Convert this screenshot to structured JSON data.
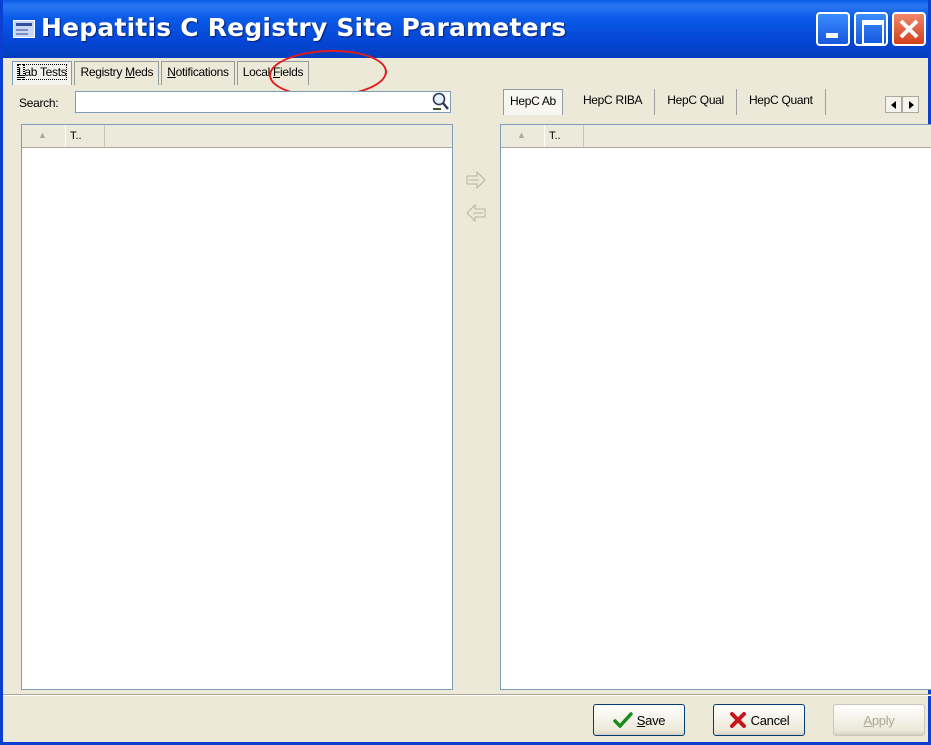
{
  "window": {
    "title": "Hepatitis C Registry Site Parameters"
  },
  "main_tabs": [
    {
      "pre": "",
      "u": "L",
      "post": "ab Tests"
    },
    {
      "pre": "Registry ",
      "u": "M",
      "post": "eds"
    },
    {
      "pre": "",
      "u": "N",
      "post": "otifications"
    },
    {
      "pre": "Local ",
      "u": "F",
      "post": "ields"
    }
  ],
  "search": {
    "label": "Search:",
    "value": ""
  },
  "left_list": {
    "sort_arrow": "▲",
    "col_header": "T.."
  },
  "right_tabs": [
    "HepC Ab",
    "HepC RIBA",
    "HepC Qual",
    "HepC Quant"
  ],
  "right_list": {
    "sort_arrow": "▲",
    "col_header": "T.."
  },
  "buttons": {
    "save_pre": "",
    "save_u": "S",
    "save_post": "ave",
    "cancel": "Cancel",
    "apply_pre": "",
    "apply_u": "A",
    "apply_post": "pply"
  },
  "colors": {
    "titlebar": "#0a5be8",
    "highlight_circle": "#e21b1b",
    "window_bg": "#ece9d8"
  }
}
